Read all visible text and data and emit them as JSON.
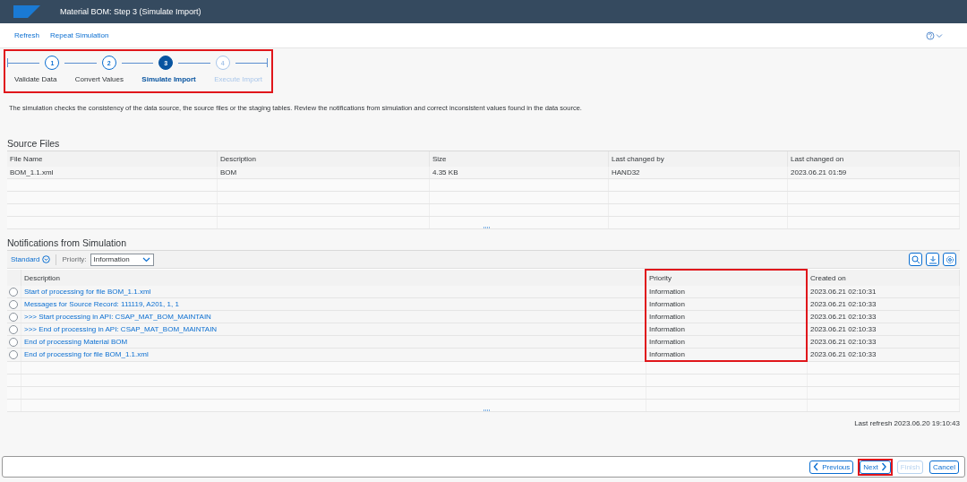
{
  "window": {
    "title": "Material BOM: Step 3  (Simulate Import)"
  },
  "toolbar": [
    "Refresh",
    "Repeat Simulation"
  ],
  "wizard": {
    "highlighted": true,
    "steps": [
      {
        "number": "1",
        "label": "Validate Data",
        "current": false,
        "disabled": false
      },
      {
        "number": "2",
        "label": "Convert Values",
        "current": false,
        "disabled": false
      },
      {
        "number": "3",
        "label": "Simulate Import",
        "current": true,
        "disabled": false
      },
      {
        "number": "4",
        "label": "Execute Import",
        "current": false,
        "disabled": true
      }
    ]
  },
  "description": "The simulation checks the consistency of the data source, the source files or the staging tables. Review the notifications from simulation and correct inconsistent values found in the data source.",
  "source_files": {
    "title": "Source Files",
    "columns": [
      {
        "label": "File Name"
      },
      {
        "label": "Description"
      },
      {
        "label": "Size"
      },
      {
        "label": "Last changed by"
      },
      {
        "label": "Last changed on"
      }
    ],
    "rows": [
      [
        "BOM_1.1.xml",
        "BOM",
        "4.35 KB",
        "HAND32",
        "2023.06.21 01:59"
      ]
    ]
  },
  "notifications": {
    "title": "Notifications from Simulation",
    "variant": "Standard",
    "filter_label": "Priority:",
    "filter_value": "Information",
    "columns": [
      {
        "label": "Description",
        "highlighted": false
      },
      {
        "label": "Priority",
        "highlighted": true
      },
      {
        "label": "Created on",
        "highlighted": false
      }
    ],
    "rows": [
      {
        "selected": false,
        "cells": [
          "Start of processing for file BOM_1.1.xml",
          "Information",
          "2023.06.21 02:10:31"
        ]
      },
      {
        "selected": false,
        "cells": [
          "Messages for Source Record: 111119, A201, 1, 1",
          "Information",
          "2023.06.21 02:10:33"
        ]
      },
      {
        "selected": false,
        "cells": [
          ">>> Start processing in API: CSAP_MAT_BOM_MAINTAIN",
          "Information",
          "2023.06.21 02:10:33"
        ]
      },
      {
        "selected": false,
        "cells": [
          ">>> End of processing in API: CSAP_MAT_BOM_MAINTAIN",
          "Information",
          "2023.06.21 02:10:33"
        ]
      },
      {
        "selected": false,
        "cells": [
          "End of processing Material BOM",
          "Information",
          "2023.06.21 02:10:33"
        ]
      },
      {
        "selected": false,
        "cells": [
          "End of processing for file BOM_1.1.xml",
          "Information",
          "2023.06.21 02:10:33"
        ]
      }
    ]
  },
  "last_refresh": "Last refresh 2023.06.20 19:10:43",
  "footer_buttons": [
    {
      "label": "Previous",
      "kind": "back",
      "disabled": false,
      "highlighted": false
    },
    {
      "label": "Next",
      "kind": "forward",
      "disabled": false,
      "highlighted": true
    },
    {
      "label": "Finish",
      "kind": "plain",
      "disabled": true,
      "highlighted": false
    },
    {
      "label": "Cancel",
      "kind": "plain",
      "disabled": false,
      "highlighted": false
    }
  ]
}
